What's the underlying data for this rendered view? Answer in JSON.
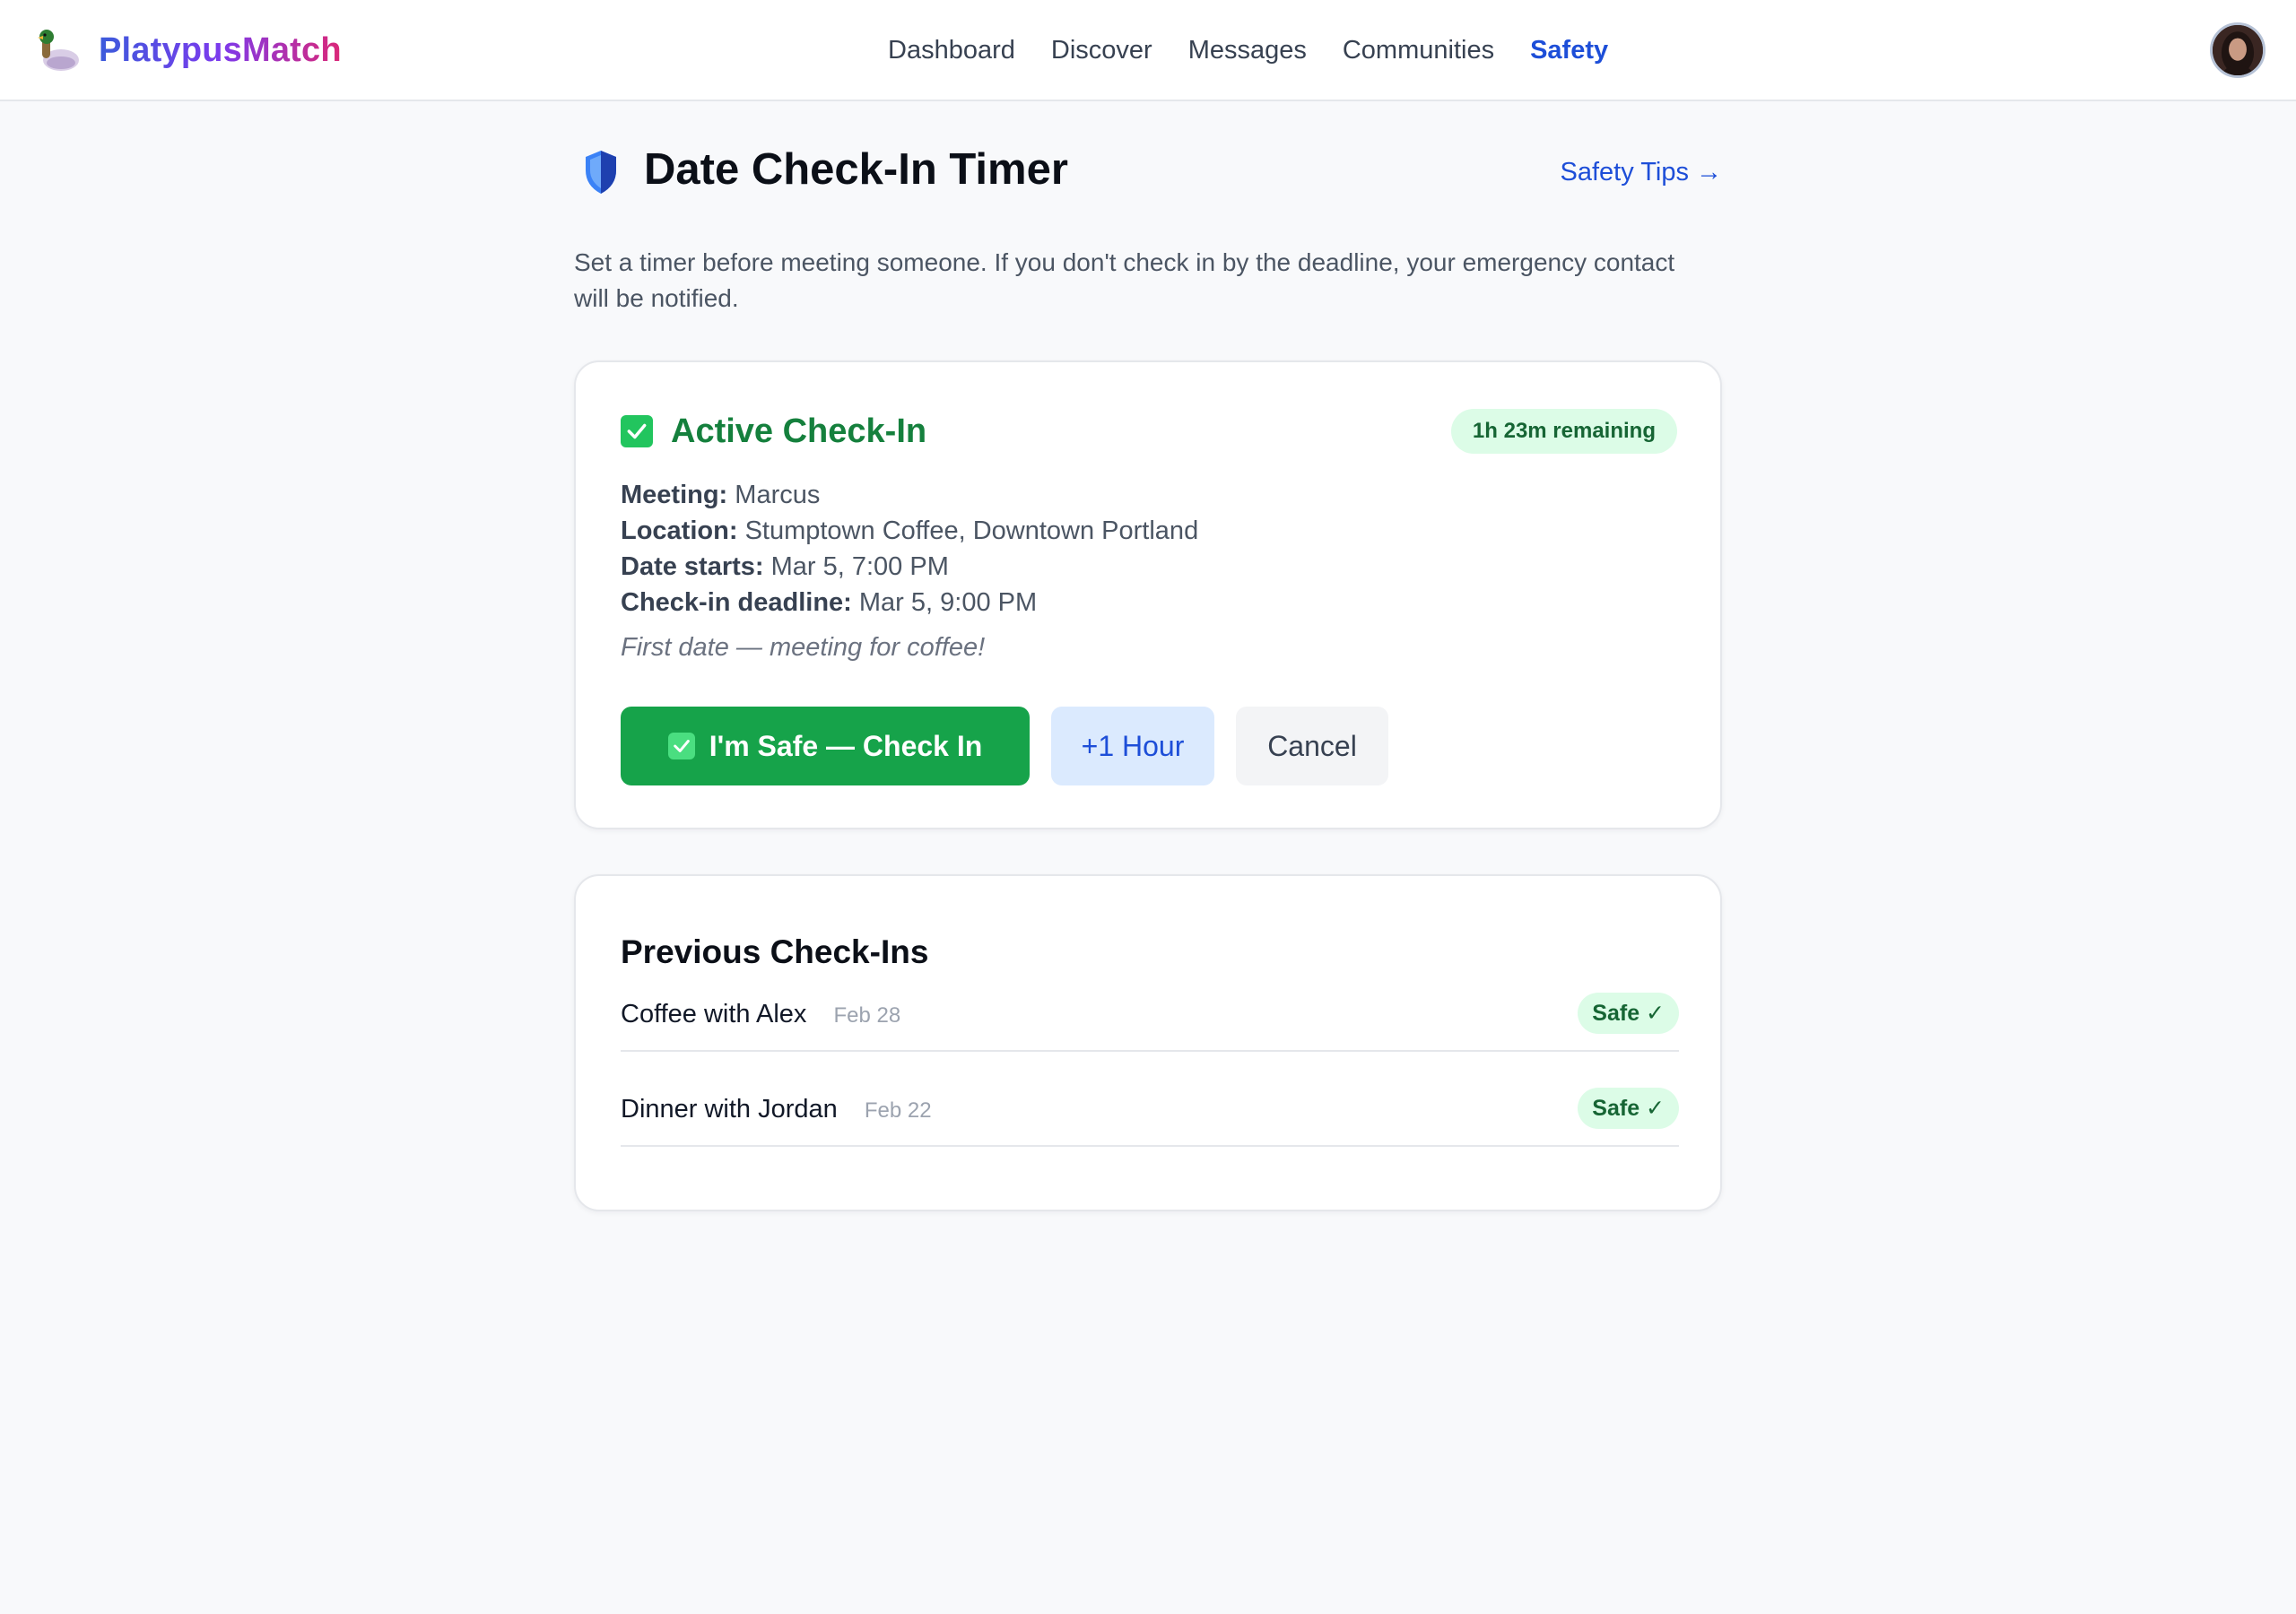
{
  "nav": {
    "brand": "PlatypusMatch",
    "links": [
      {
        "label": "Dashboard",
        "active": false
      },
      {
        "label": "Discover",
        "active": false
      },
      {
        "label": "Messages",
        "active": false
      },
      {
        "label": "Communities",
        "active": false
      },
      {
        "label": "Safety",
        "active": true
      }
    ],
    "accent_color": "#1d4ed8"
  },
  "page": {
    "title": "Date Check-In Timer",
    "tips_link": "Safety Tips →",
    "description": "Set a timer before meeting someone. If you don't check in by the deadline, your emergency contact will be notified."
  },
  "active_checkin": {
    "title": "Active Check-In",
    "remaining": "1h 23m remaining",
    "fields": [
      {
        "label": "Meeting:",
        "value": "Marcus"
      },
      {
        "label": "Location:",
        "value": "Stumptown Coffee, Downtown Portland"
      },
      {
        "label": "Date starts:",
        "value": "Mar 5, 7:00 PM"
      },
      {
        "label": "Check-in deadline:",
        "value": "Mar 5, 9:00 PM"
      }
    ],
    "note": "First date — meeting for coffee!",
    "buttons": {
      "safe": "I'm Safe — Check In",
      "extend": "+1 Hour",
      "cancel": "Cancel"
    },
    "status_color": "#16a34a"
  },
  "history": {
    "title": "Previous Check-Ins",
    "items": [
      {
        "name": "Coffee with Alex",
        "date": "Feb 28",
        "status": "Safe ✓"
      },
      {
        "name": "Dinner with Jordan",
        "date": "Feb 22",
        "status": "Safe ✓"
      }
    ]
  }
}
